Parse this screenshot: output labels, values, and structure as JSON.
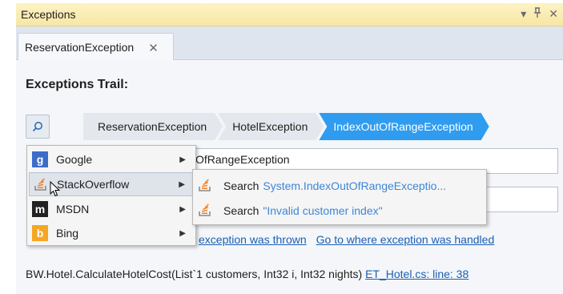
{
  "window": {
    "title": "Exceptions"
  },
  "window_controls": {
    "dropdown": "▾",
    "pin": "ᵖ",
    "close": "✕"
  },
  "tab": {
    "label": "ReservationException",
    "close": "✕"
  },
  "panel": {
    "heading": "Exceptions Trail:"
  },
  "breadcrumb": [
    "ReservationException",
    "HotelException",
    "IndexOutOfRangeException"
  ],
  "fields": {
    "type_partial": "OfRangeException",
    "message_partial": ""
  },
  "links": {
    "thrown": "exception was thrown",
    "handled": "Go to where exception was handled"
  },
  "trace": {
    "method": "BW.Hotel.CalculateHotelCost(List`1 customers, Int32 i, Int32 nights)",
    "location": "ET_Hotel.cs: line: 38"
  },
  "menu": {
    "items": [
      {
        "label": "Google",
        "icon": "google-icon"
      },
      {
        "label": "StackOverflow",
        "icon": "stackoverflow-icon"
      },
      {
        "label": "MSDN",
        "icon": "msdn-icon"
      },
      {
        "label": "Bing",
        "icon": "bing-icon"
      }
    ]
  },
  "submenu": {
    "items": [
      {
        "prefix": "Search",
        "query": "System.IndexOutOfRangeExceptio..."
      },
      {
        "prefix": "Search",
        "query": "\"Invalid customer index\""
      }
    ]
  },
  "colors": {
    "accent": "#2f9cf0",
    "link": "#1a5fb4",
    "title_bar": "#f6e7a6"
  }
}
